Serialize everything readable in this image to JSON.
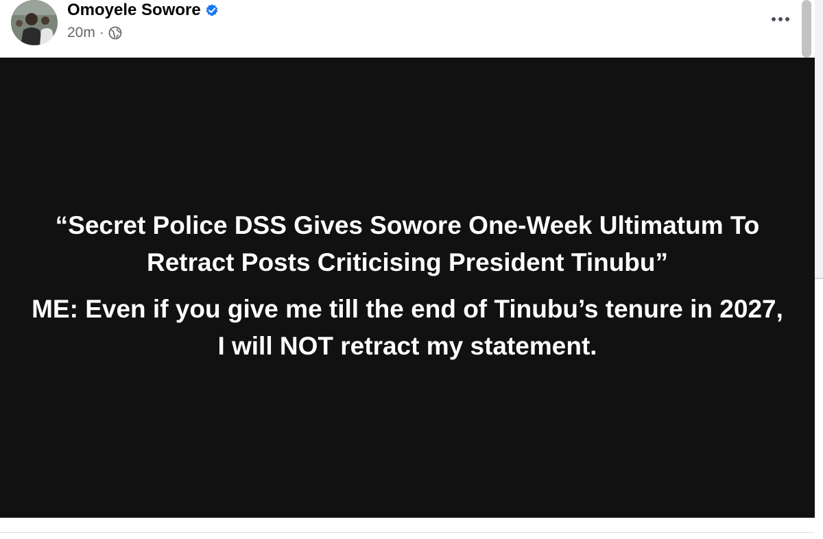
{
  "post": {
    "author": "Omoyele Sowore",
    "timestamp": "20m",
    "separator": "·",
    "privacy_icon": "globe-icon",
    "verified_icon": "verified-badge-icon",
    "more_icon": "more-options-icon",
    "content": {
      "paragraph_1": "“Secret Police DSS Gives Sowore One-Week Ultimatum To Retract Posts Criticising President Tinubu”",
      "paragraph_2": "ME: Even if you give me till the end of Tinubu’s tenure in 2027, I will NOT retract my statement."
    },
    "background_color": "#111111",
    "text_color": "#ffffff"
  },
  "colors": {
    "verified_blue": "#1877f2",
    "meta_gray": "#65676b"
  }
}
